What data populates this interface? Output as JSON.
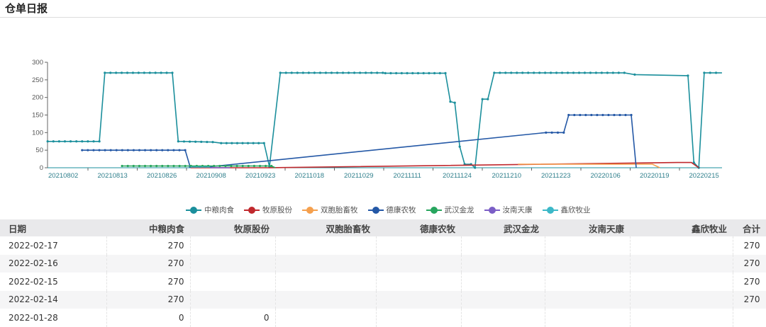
{
  "header": {
    "title": "仓单日报"
  },
  "chart_data": {
    "type": "line",
    "title": "",
    "xlabel": "",
    "ylabel": "",
    "x_ticks": [
      "20210802",
      "20210813",
      "20210826",
      "20210908",
      "20210923",
      "20211018",
      "20211029",
      "20211111",
      "20211124",
      "20211210",
      "20211223",
      "20220106",
      "20220119",
      "20220215"
    ],
    "x_note": "x values are positions in tick-label index units",
    "xlim": [
      -0.3,
      13.4
    ],
    "ylim": [
      0,
      300
    ],
    "y_ticks": [
      0,
      50,
      100,
      150,
      200,
      250,
      300
    ],
    "legend_position": "bottom",
    "series": [
      {
        "name": "中粮肉食",
        "color": "#1b8f9c",
        "dots": true,
        "points": [
          [
            -0.3,
            75
          ],
          [
            0.75,
            75
          ],
          [
            0.86,
            270
          ],
          [
            2.23,
            270
          ],
          [
            2.35,
            75
          ],
          [
            3.05,
            73
          ],
          [
            3.22,
            70
          ],
          [
            4.09,
            70
          ],
          [
            4.2,
            3
          ],
          [
            4.42,
            270
          ],
          [
            6.5,
            270
          ],
          [
            6.55,
            269
          ],
          [
            7.77,
            269
          ],
          [
            7.87,
            188
          ],
          [
            7.96,
            185
          ],
          [
            8.06,
            60
          ],
          [
            8.16,
            10
          ],
          [
            8.29,
            10
          ],
          [
            8.37,
            0
          ],
          [
            8.52,
            195
          ],
          [
            8.63,
            195
          ],
          [
            8.76,
            270
          ],
          [
            11.4,
            270
          ],
          [
            11.61,
            265
          ],
          [
            12.69,
            262
          ],
          [
            12.81,
            15
          ],
          [
            12.91,
            0
          ],
          [
            13.02,
            270
          ],
          [
            13.38,
            270
          ]
        ]
      },
      {
        "name": "牧原股份",
        "color": "#c0282d",
        "dots": false,
        "points": [
          [
            2.6,
            0
          ],
          [
            4.2,
            0
          ],
          [
            12.47,
            15
          ],
          [
            12.76,
            15
          ],
          [
            12.91,
            0
          ]
        ]
      },
      {
        "name": "双胞胎畜牧",
        "color": "#f5a04e",
        "dots": false,
        "points": [
          [
            9.24,
            10
          ],
          [
            11.97,
            10
          ],
          [
            12.12,
            0
          ]
        ]
      },
      {
        "name": "德康农牧",
        "color": "#2458a6",
        "dots": true,
        "points": [
          [
            0.4,
            50
          ],
          [
            2.49,
            50
          ],
          [
            2.59,
            3
          ],
          [
            3.0,
            3
          ],
          [
            9.81,
            100
          ],
          [
            10.17,
            100
          ],
          [
            10.27,
            150
          ],
          [
            11.54,
            150
          ],
          [
            11.64,
            0
          ]
        ]
      },
      {
        "name": "武汉金龙",
        "color": "#27a55e",
        "dots": true,
        "points": [
          [
            1.21,
            5
          ],
          [
            4.24,
            5
          ],
          [
            4.32,
            0
          ]
        ]
      },
      {
        "name": "汝南天康",
        "color": "#7b5ec6",
        "dots": false,
        "points": [
          [
            3.0,
            0
          ],
          [
            3.4,
            0
          ]
        ]
      },
      {
        "name": "鑫欣牧业",
        "color": "#3cb8c8",
        "dots": false,
        "points": [
          [
            2.6,
            2
          ],
          [
            3.0,
            2
          ]
        ]
      }
    ]
  },
  "table": {
    "columns": [
      "日期",
      "中粮肉食",
      "牧原股份",
      "双胞胎畜牧",
      "德康农牧",
      "武汉金龙",
      "汝南天康",
      "鑫欣牧业",
      "合计"
    ],
    "rows": [
      [
        "2022-02-17",
        "270",
        "",
        "",
        "",
        "",
        "",
        "",
        "270"
      ],
      [
        "2022-02-16",
        "270",
        "",
        "",
        "",
        "",
        "",
        "",
        "270"
      ],
      [
        "2022-02-15",
        "270",
        "",
        "",
        "",
        "",
        "",
        "",
        "270"
      ],
      [
        "2022-02-14",
        "270",
        "",
        "",
        "",
        "",
        "",
        "",
        "270"
      ],
      [
        "2022-01-28",
        "0",
        "0",
        "",
        "",
        "",
        "",
        "",
        ""
      ]
    ]
  }
}
